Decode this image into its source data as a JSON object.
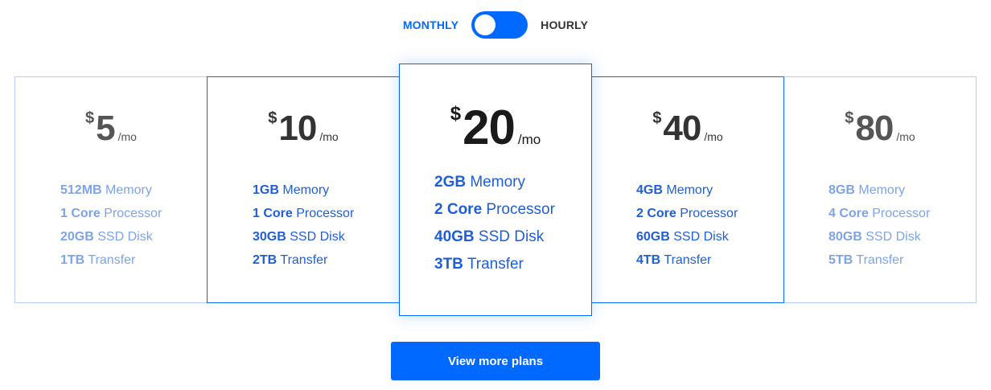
{
  "billing_toggle": {
    "left_label": "MONTHLY",
    "right_label": "HOURLY",
    "selected": "MONTHLY"
  },
  "plans": [
    {
      "currency": "$",
      "amount": "5",
      "period": "/mo",
      "specs": [
        {
          "value": "512MB",
          "label": "Memory"
        },
        {
          "value": "1 Core",
          "label": "Processor"
        },
        {
          "value": "20GB",
          "label": "SSD Disk"
        },
        {
          "value": "1TB",
          "label": "Transfer"
        }
      ]
    },
    {
      "currency": "$",
      "amount": "10",
      "period": "/mo",
      "specs": [
        {
          "value": "1GB",
          "label": "Memory"
        },
        {
          "value": "1 Core",
          "label": "Processor"
        },
        {
          "value": "30GB",
          "label": "SSD Disk"
        },
        {
          "value": "2TB",
          "label": "Transfer"
        }
      ]
    },
    {
      "currency": "$",
      "amount": "20",
      "period": "/mo",
      "specs": [
        {
          "value": "2GB",
          "label": "Memory"
        },
        {
          "value": "2 Core",
          "label": "Processor"
        },
        {
          "value": "40GB",
          "label": "SSD Disk"
        },
        {
          "value": "3TB",
          "label": "Transfer"
        }
      ]
    },
    {
      "currency": "$",
      "amount": "40",
      "period": "/mo",
      "specs": [
        {
          "value": "4GB",
          "label": "Memory"
        },
        {
          "value": "2 Core",
          "label": "Processor"
        },
        {
          "value": "60GB",
          "label": "SSD Disk"
        },
        {
          "value": "4TB",
          "label": "Transfer"
        }
      ]
    },
    {
      "currency": "$",
      "amount": "80",
      "period": "/mo",
      "specs": [
        {
          "value": "8GB",
          "label": "Memory"
        },
        {
          "value": "4 Core",
          "label": "Processor"
        },
        {
          "value": "80GB",
          "label": "SSD Disk"
        },
        {
          "value": "5TB",
          "label": "Transfer"
        }
      ]
    }
  ],
  "cta": {
    "label": "View more plans"
  },
  "colors": {
    "accent": "#0069ff",
    "spec_text": "#1f5fd6",
    "spec_text_faded": "#7da4e8",
    "price_text": "#333333"
  }
}
